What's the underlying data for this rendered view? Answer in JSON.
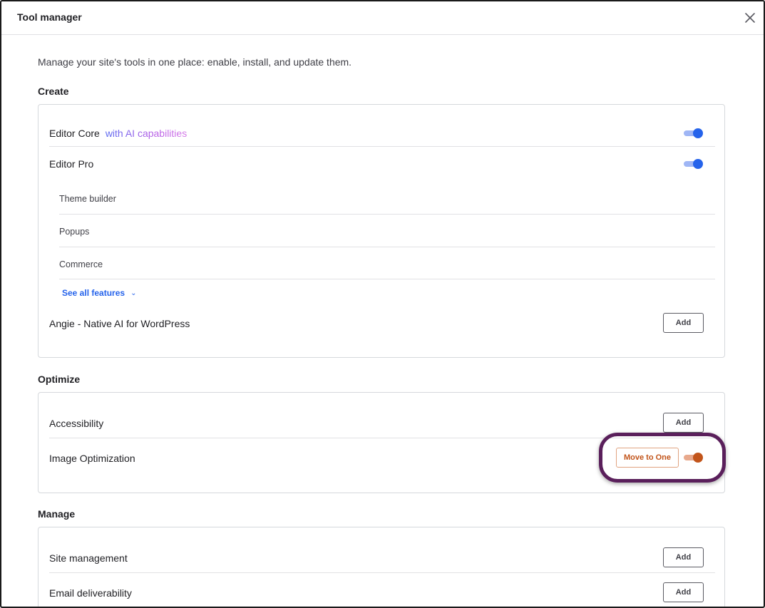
{
  "modal": {
    "title": "Tool manager",
    "close_icon": "close-icon"
  },
  "intro": "Manage your site's tools in one place: enable, install, and update them.",
  "colors": {
    "toggle_on_blue": "#2563eb",
    "toggle_on_orange": "#c2541a",
    "link_blue": "#2563eb",
    "highlight_ring": "#5a1f5b"
  },
  "sections": {
    "create": {
      "title": "Create",
      "editor_core": {
        "label": "Editor Core",
        "tag": "with AI capabilities",
        "enabled": true
      },
      "editor_pro": {
        "label": "Editor Pro",
        "enabled": true,
        "features": [
          "Theme builder",
          "Popups",
          "Commerce"
        ],
        "see_all": "See all features",
        "see_all_icon": "chevron-down-icon"
      },
      "angie": {
        "label": "Angie - Native AI for WordPress",
        "action": "Add"
      }
    },
    "optimize": {
      "title": "Optimize",
      "accessibility": {
        "label": "Accessibility",
        "action": "Add"
      },
      "image_optimization": {
        "label": "Image Optimization",
        "action": "Move to One",
        "enabled": true
      }
    },
    "manage": {
      "title": "Manage",
      "site_management": {
        "label": "Site management",
        "action": "Add"
      },
      "email_deliverability": {
        "label": "Email deliverability",
        "action": "Add"
      }
    }
  }
}
